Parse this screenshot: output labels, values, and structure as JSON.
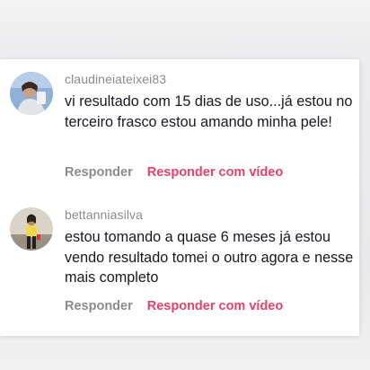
{
  "comments": [
    {
      "username": "claudineiateixei83",
      "text": "vi resultado com 15 dias de uso...já estou no terceiro frasco estou amando minha pele!",
      "reply_label": "Responder",
      "reply_video_label": "Responder com vídeo"
    },
    {
      "username": "bettanniasilva",
      "text": "estou tomando a quase 6 meses já estou vendo resultado tomei o outro agora e nesse mais completo",
      "reply_label": "Responder",
      "reply_video_label": "Responder com vídeo"
    }
  ],
  "colors": {
    "accent": "#e8416b",
    "secondary_text": "#8a8b91",
    "primary_text": "#161823"
  }
}
